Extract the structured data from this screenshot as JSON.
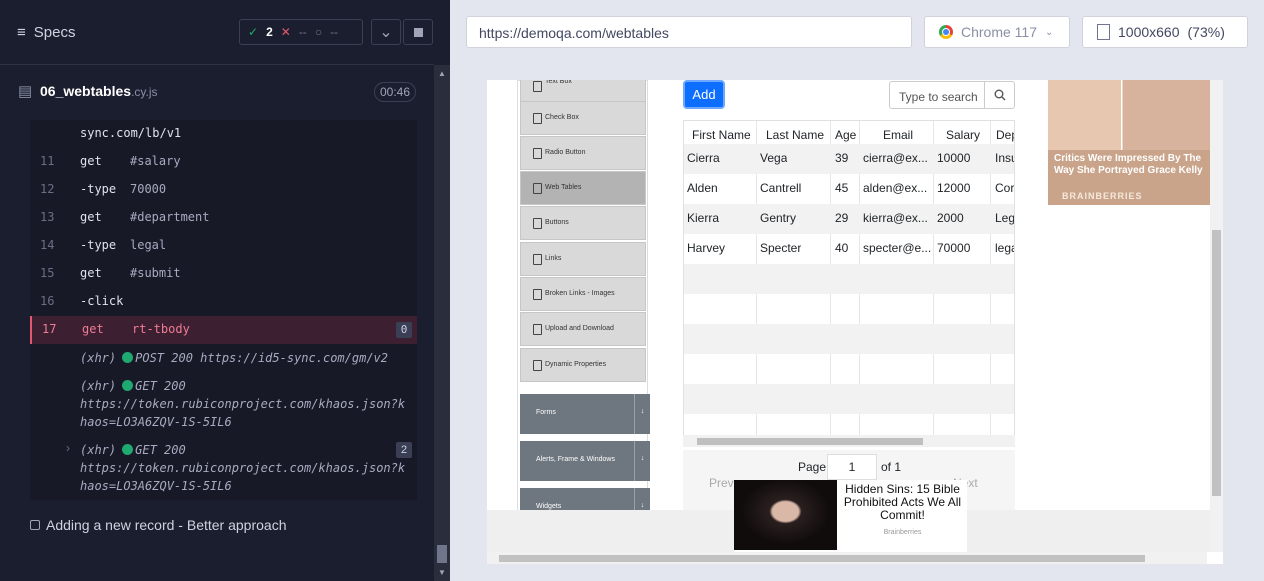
{
  "runner": {
    "specs_label": "Specs",
    "stats": {
      "passed": "2",
      "failed": "--",
      "pending": "--"
    },
    "file": {
      "name": "06_webtables",
      "ext": ".cy.js",
      "duration": "00:46"
    },
    "commands": [
      {
        "num": "",
        "name": "",
        "arg": "sync.com/lb/v1"
      },
      {
        "num": "11",
        "name": "get",
        "arg": "#salary"
      },
      {
        "num": "12",
        "name": "-type",
        "arg": "70000"
      },
      {
        "num": "13",
        "name": "get",
        "arg": "#department"
      },
      {
        "num": "14",
        "name": "-type",
        "arg": "legal"
      },
      {
        "num": "15",
        "name": "get",
        "arg": "#submit"
      },
      {
        "num": "16",
        "name": "-click",
        "arg": ""
      },
      {
        "num": "17",
        "name": "get",
        "arg": "rt-tbody",
        "badge": "0"
      }
    ],
    "xhr": [
      {
        "label": "(xhr)",
        "method": "POST 200",
        "url": "https://id5-sync.com/gm/v2"
      },
      {
        "label": "(xhr)",
        "method": "GET 200",
        "url": "https://token.rubiconproject.com/khaos.json?khaos=LO3A6ZQV-1S-5IL6"
      },
      {
        "label": "(xhr)",
        "method": "GET 200",
        "url": "https://token.rubiconproject.com/khaos.json?khaos=LO3A6ZQV-1S-5IL6",
        "badge": "2"
      }
    ],
    "test_title": "Adding a new record - Better approach"
  },
  "browser": {
    "url": "https://demoqa.com/webtables",
    "name": "Chrome 117",
    "viewport": "1000x660",
    "scale": "(73%)"
  },
  "aut": {
    "sidebar_items": [
      "Text Box",
      "Check Box",
      "Radio Button",
      "Web Tables",
      "Buttons",
      "Links",
      "Broken Links - Images",
      "Upload and Download",
      "Dynamic Properties"
    ],
    "selected_item": "Web Tables",
    "groups": [
      "Forms",
      "Alerts, Frame & Windows",
      "Widgets"
    ],
    "add_label": "Add",
    "search_placeholder": "Type to search",
    "table": {
      "headers": [
        "First Name",
        "Last Name",
        "Age",
        "Email",
        "Salary",
        "Dep"
      ],
      "rows": [
        [
          "Cierra",
          "Vega",
          "39",
          "cierra@ex...",
          "10000",
          "Insu"
        ],
        [
          "Alden",
          "Cantrell",
          "45",
          "alden@ex...",
          "12000",
          "Cor"
        ],
        [
          "Kierra",
          "Gentry",
          "29",
          "kierra@ex...",
          "2000",
          "Leg"
        ],
        [
          "Harvey",
          "Specter",
          "40",
          "specter@e...",
          "70000",
          "lega"
        ]
      ]
    },
    "pager": {
      "prev": "Prev",
      "page_label": "Page",
      "page_value": "1",
      "of_label": "of 1",
      "next": "Next"
    },
    "ad_bottom": {
      "text": "Hidden Sins: 15 Bible Prohibited Acts We All Commit!",
      "brand": "Brainberries"
    },
    "ad_right": {
      "text": "Critics Were Impressed By The Way She Portrayed Grace Kelly",
      "brand": "BRAINBERRIES"
    }
  }
}
